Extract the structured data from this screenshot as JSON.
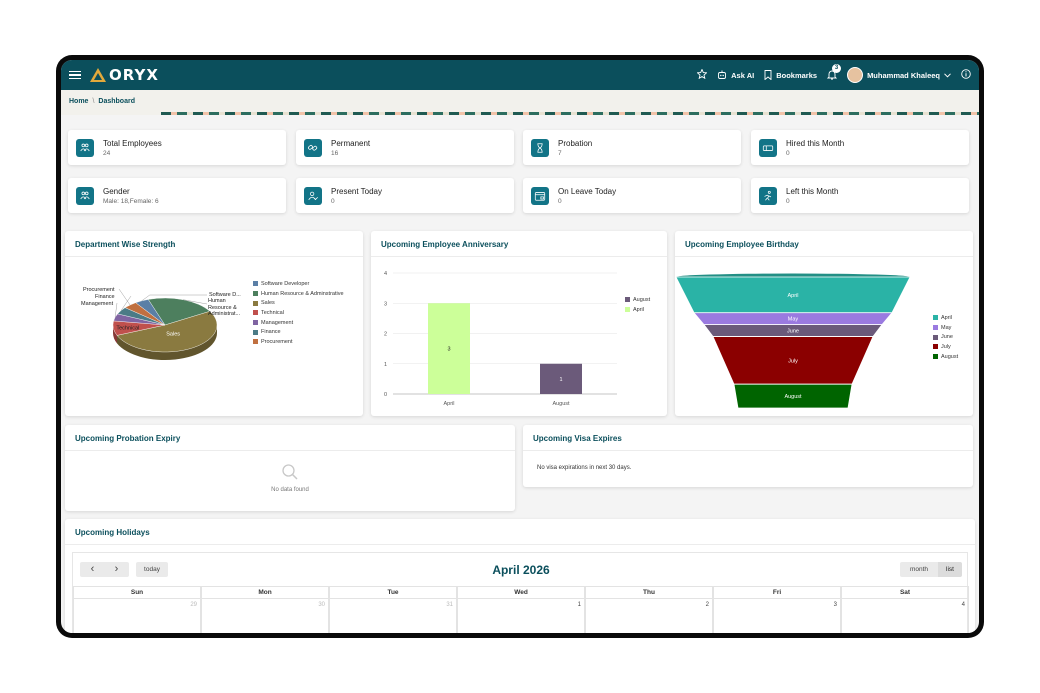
{
  "app": {
    "logo_text": "ORYX",
    "brand_color": "#0b4f5c",
    "accent_color": "#127487"
  },
  "topbar": {
    "ask_ai": "Ask AI",
    "bookmarks": "Bookmarks",
    "notification_count": "3",
    "user_name": "Muhammad Khaleeq"
  },
  "breadcrumb": {
    "home": "Home",
    "separator": "\\",
    "current": "Dashboard"
  },
  "stats": [
    {
      "label": "Total Employees",
      "value": "24",
      "icon": "users-icon"
    },
    {
      "label": "Permanent",
      "value": "16",
      "icon": "link-icon"
    },
    {
      "label": "Probation",
      "value": "7",
      "icon": "hourglass-icon"
    },
    {
      "label": "Hired this Month",
      "value": "0",
      "icon": "ticket-icon"
    },
    {
      "label": "Gender",
      "value": "Male: 18,Female: 6",
      "icon": "gender-icon"
    },
    {
      "label": "Present Today",
      "value": "0",
      "icon": "user-check-icon"
    },
    {
      "label": "On Leave Today",
      "value": "0",
      "icon": "calendar-leave-icon"
    },
    {
      "label": "Left this Month",
      "value": "0",
      "icon": "running-icon"
    }
  ],
  "panels": {
    "department": "Department Wise Strength",
    "anniversary": "Upcoming Employee Anniversary",
    "birthday": "Upcoming Employee Birthday",
    "probation": "Upcoming Probation Expiry",
    "probation_empty": "No data found",
    "visa": "Upcoming Visa Expires",
    "visa_empty": "No visa expirations in next 30 days.",
    "holidays": "Upcoming Holidays"
  },
  "chart_data": [
    {
      "type": "pie",
      "title": "Department Wise Strength",
      "categories": [
        "Software Developer",
        "Human Resource & Adminstrative",
        "Sales",
        "Technical",
        "Management",
        "Finance",
        "Procurement"
      ],
      "values": [
        1,
        5,
        12,
        2,
        1,
        1,
        1
      ],
      "colors": [
        "#5b7fa6",
        "#4d7f5e",
        "#8a7a40",
        "#c0504d",
        "#8064a2",
        "#4b7b86",
        "#c07040"
      ],
      "slice_labels": [
        "Software D...",
        "Human Resource & Administrat...",
        "Sales",
        "Technical",
        "Management",
        "Finance",
        "Procurement"
      ],
      "legend_position": "right"
    },
    {
      "type": "bar",
      "title": "Upcoming Employee Anniversary",
      "categories": [
        "April",
        "August"
      ],
      "series": [
        {
          "name": "August",
          "values": [
            0,
            1
          ],
          "color": "#6b5a7a"
        },
        {
          "name": "April",
          "values": [
            3,
            0
          ],
          "color": "#ccff99"
        }
      ],
      "data_labels": [
        "3",
        "1"
      ],
      "yticks": [
        "0",
        "1",
        "2",
        "3",
        "4"
      ],
      "ylim": [
        0,
        4
      ],
      "grid": true,
      "legend_position": "right"
    },
    {
      "type": "funnel",
      "title": "Upcoming Employee Birthday",
      "categories": [
        "April",
        "May",
        "June",
        "July",
        "August"
      ],
      "values": [
        3,
        1,
        1,
        4,
        2
      ],
      "colors": [
        "#2ab3a6",
        "#9a7ae0",
        "#6a5a7a",
        "#8b0000",
        "#006400"
      ],
      "legend_position": "right"
    }
  ],
  "calendar": {
    "title": "April 2026",
    "prev_icon": "‹",
    "next_icon": "›",
    "today": "today",
    "view_month": "month",
    "view_list": "list",
    "days": [
      "Sun",
      "Mon",
      "Tue",
      "Wed",
      "Thu",
      "Fri",
      "Sat"
    ],
    "first_week": [
      "29",
      "30",
      "31",
      "1",
      "2",
      "3",
      "4"
    ]
  }
}
